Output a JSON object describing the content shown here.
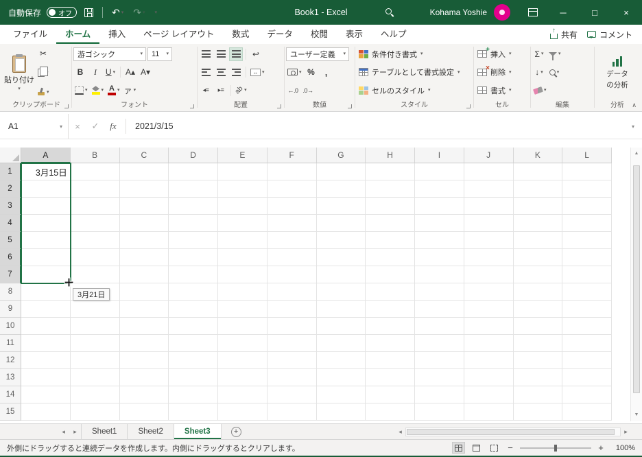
{
  "colors": {
    "titlebar_green": "#185C37",
    "accent_green": "#217346",
    "fill_color": "#FFF000",
    "font_color": "#C00000",
    "avatar_pink": "#E3008C"
  },
  "icons": {
    "chev": "▾",
    "undo": "↶",
    "redo": "↷",
    "minimize": "─",
    "maximize": "□",
    "close": "×",
    "cut": "✂",
    "bold": "B",
    "italic": "I",
    "underline": "U",
    "font_bigger": "A▴",
    "font_smaller": "A▾",
    "font_color_a": "A",
    "ruby": "ァ",
    "orientation": "ab",
    "wrap": "↩",
    "merge_arrows": "↔",
    "percent": "%",
    "comma": ",",
    "inc_decimal": "←.0",
    "dec_decimal": ".0→",
    "sum": "Σ",
    "fill": "↓",
    "cancel": "×",
    "enter": "✓",
    "fx": "fx",
    "indent_dec": "◂≡",
    "indent_inc": "▸≡",
    "scroll_up": "▲",
    "scroll_down": "▼",
    "scroll_left": "◂",
    "scroll_right": "▸",
    "tab_prev": "◂",
    "tab_next": "▸",
    "add_sheet": "+",
    "zoom_out": "−",
    "zoom_in": "+",
    "collapse_ribbon": "∧"
  },
  "titlebar": {
    "autosave_label": "自動保存",
    "autosave_state": "オフ",
    "doc_title": "Book1 - Excel",
    "user_name": "Kohama Yoshie"
  },
  "ribbon_tabs": {
    "items": [
      "ファイル",
      "ホーム",
      "挿入",
      "ページ レイアウト",
      "数式",
      "データ",
      "校閲",
      "表示",
      "ヘルプ"
    ],
    "active": "ホーム",
    "share_label": "共有",
    "comments_label": "コメント"
  },
  "ribbon": {
    "paste_label": "貼り付け",
    "font_name": "游ゴシック",
    "font_size": "11",
    "number_format": "ユーザー定義",
    "style_buttons": [
      "条件付き書式",
      "テーブルとして書式設定",
      "セルのスタイル"
    ],
    "cell_buttons": [
      "挿入",
      "削除",
      "書式"
    ],
    "analysis_label_1": "データ",
    "analysis_label_2": "の分析",
    "group_labels": [
      "クリップボード",
      "フォント",
      "配置",
      "数値",
      "スタイル",
      "セル",
      "編集",
      "分析"
    ]
  },
  "formula_bar": {
    "name_box": "A1",
    "value": "2021/3/15"
  },
  "grid": {
    "columns": [
      "A",
      "B",
      "C",
      "D",
      "E",
      "F",
      "G",
      "H",
      "I",
      "J",
      "K",
      "L"
    ],
    "rows": [
      "1",
      "2",
      "3",
      "4",
      "5",
      "6",
      "7",
      "8",
      "9",
      "10",
      "11",
      "12",
      "13",
      "14",
      "15"
    ],
    "cells": {
      "A1": "3月15日"
    },
    "fill_tooltip": "3月21日",
    "selection": {
      "range": "A1:A7",
      "columns": [
        "A"
      ],
      "rows": [
        "1",
        "2",
        "3",
        "4",
        "5",
        "6",
        "7"
      ]
    }
  },
  "sheets": {
    "tabs": [
      "Sheet1",
      "Sheet2",
      "Sheet3"
    ],
    "active": "Sheet3"
  },
  "statusbar": {
    "message": "外側にドラッグすると連続データを作成します。内側にドラッグするとクリアします。",
    "zoom": "100%"
  }
}
